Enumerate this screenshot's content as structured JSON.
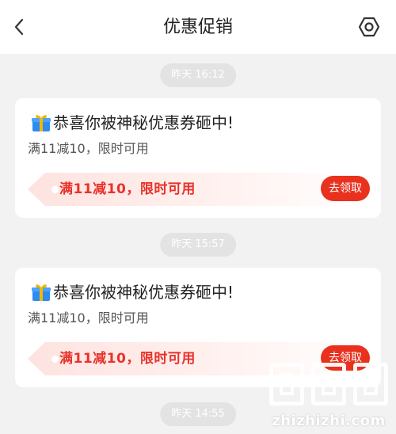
{
  "header": {
    "title": "优惠促销",
    "back_icon": "chevron-left-icon",
    "settings_icon": "hexagon-settings-icon"
  },
  "messages": [
    {
      "time": "昨天 16:12",
      "title": "恭喜你被神秘优惠券砸中!",
      "subtitle": "满11减10，限时可用",
      "coupon_text": "满11减10，限时可用",
      "button_label": "去领取"
    },
    {
      "time": "昨天 15:57",
      "title": "恭喜你被神秘优惠券砸中!",
      "subtitle": "满11减10，限时可用",
      "coupon_text": "满11减10，限时可用",
      "button_label": "去领取"
    },
    {
      "time": "昨天 14:55"
    }
  ],
  "watermark": {
    "text": "zhizhizhi.com"
  },
  "colors": {
    "accent": "#e8321e",
    "coupon_text": "#e8322a",
    "coupon_bg_start": "#fde3e0",
    "coupon_bg_end": "#ffffff",
    "page_bg": "#f2f2f2",
    "timestamp_bg": "#e3e3e3"
  }
}
